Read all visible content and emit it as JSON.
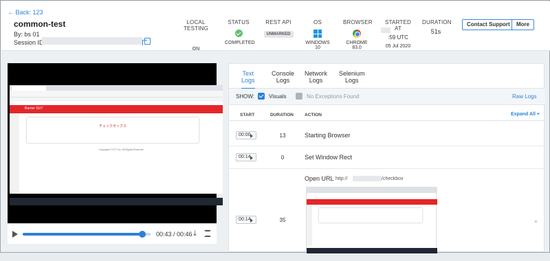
{
  "header": {
    "back_label": "← Back: 123",
    "project": "common-test",
    "by": "By: bs 01",
    "session_label": "Session ID:",
    "columns": [
      {
        "heading": "LOCAL TESTING",
        "value": "ON"
      },
      {
        "heading": "STATUS",
        "value": "COMPLETED"
      },
      {
        "heading": "REST API",
        "value": "UNMARKED"
      },
      {
        "heading": "OS",
        "value": "WINDOWS 10"
      },
      {
        "heading": "BROWSER",
        "value": "CHROME 83.0"
      },
      {
        "heading": "STARTED AT",
        "time": ":59 UTC",
        "date": "05 Jul 2020"
      },
      {
        "heading": "DURATION",
        "value": "51s"
      }
    ],
    "contact_support": "Contact Support",
    "more": "More"
  },
  "video": {
    "time": "00:43 / 00:46",
    "progress": 0.935,
    "screen_header": "Barrier SUT",
    "screen_card_title": "チェックボックス",
    "screen_footer": "Copyright © HTT Inc. All Rights Reserved."
  },
  "logs": {
    "tabs": [
      {
        "line1": "Text",
        "line2": "Logs",
        "active": true
      },
      {
        "line1": "Console",
        "line2": "Logs",
        "active": false
      },
      {
        "line1": "Network",
        "line2": "Logs",
        "active": false
      },
      {
        "line1": "Selenium",
        "line2": "Logs",
        "active": false
      }
    ],
    "show_label": "SHOW:",
    "visuals_label": "Visuals",
    "no_exceptions_label": "No Exceptions Found",
    "raw_logs": "Raw Logs",
    "columns": [
      "START",
      "DURATION",
      "ACTION"
    ],
    "expand_all": "Expand All +",
    "rows": [
      {
        "start": "00:00",
        "duration": "13",
        "action": "Starting Browser"
      },
      {
        "start": "00:14",
        "duration": "0",
        "action": "Set Window Rect"
      },
      {
        "start": "00:14",
        "duration": "35",
        "action": "Open URL",
        "url_prefix": "http://",
        "url_suffix": "/checkbox"
      }
    ]
  },
  "colors": {
    "accent": "#2f83d6",
    "success": "#63c072",
    "brand_red": "#e52629"
  }
}
